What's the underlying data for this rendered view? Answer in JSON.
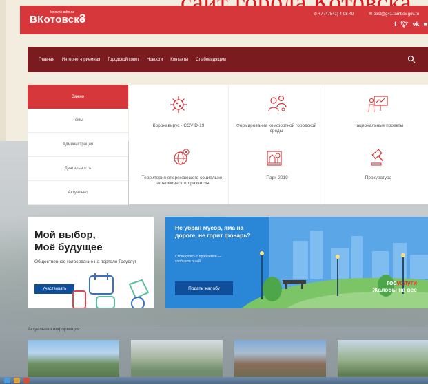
{
  "slide_title": "сайт города Котовска",
  "header": {
    "logo_small": "kotovsk-adm.ru",
    "logo_text": "ВКотовске",
    "phone": "+7 (47541) 4-08-40",
    "email": "post@g41.tambov.gov.ru",
    "social": [
      "f",
      "♥",
      "vk",
      "ok"
    ]
  },
  "nav": {
    "items": [
      "Главная",
      "Интернет-приемная",
      "Городской совет",
      "Новости",
      "Контакты",
      "Слабовидящим"
    ]
  },
  "sidebar": {
    "items": [
      "Важно",
      "Темы",
      "Администрация",
      "Деятельность",
      "Актуально"
    ]
  },
  "topics": [
    {
      "label": "Коронавирус - COVID-19",
      "icon": "virus-icon"
    },
    {
      "label": "Формирование комфортной городской среды",
      "icon": "people-icon"
    },
    {
      "label": "Национальные проекты",
      "icon": "presentation-icon"
    },
    {
      "label": "Территория опережающего социально-экономического развития",
      "icon": "globe-icon"
    },
    {
      "label": "Парк-2019",
      "icon": "park-icon"
    },
    {
      "label": "Прокуратура",
      "icon": "gavel-icon"
    }
  ],
  "banner_vote": {
    "title_line1": "Мой выбор,",
    "title_line2": "Моё будущее",
    "subtitle": "Общественное голосование на портале Госуслуг",
    "button": "Участвовать"
  },
  "banner_complaint": {
    "title": "Не убран мусор, яма на дороге, не горит фонарь?",
    "subtitle": "Столкнулись с проблемой — сообщите о ней!",
    "button": "Подать жалобу",
    "brand_part1": "гос",
    "brand_part2": "услуги",
    "brand_line2": "Жалобы на всё"
  },
  "news": {
    "label": "Актуальная информация"
  },
  "colors": {
    "header_red": "#d6373b",
    "nav_dark": "#7a1b1f",
    "button_blue": "#0f4f99",
    "banner_blue": "#2a86d6"
  }
}
